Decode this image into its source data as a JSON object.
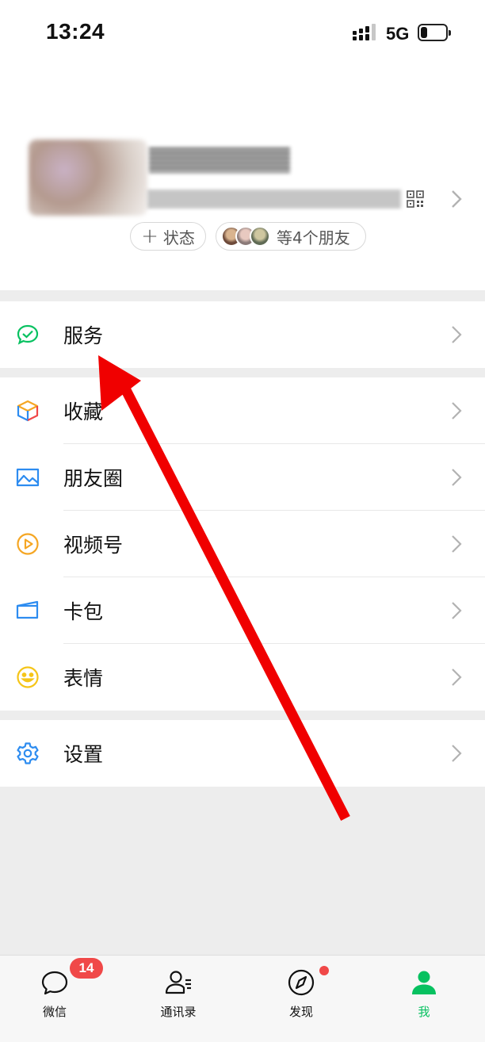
{
  "status_bar": {
    "time": "13:24",
    "network": "5G"
  },
  "profile": {
    "status_label": "状态",
    "friends_label": "等4个朋友"
  },
  "menu": {
    "service": "服务",
    "favorites": "收藏",
    "moments": "朋友圈",
    "channels": "视频号",
    "cards": "卡包",
    "stickers": "表情",
    "settings": "设置"
  },
  "tabbar": {
    "chats": "微信",
    "chats_badge": "14",
    "contacts": "通讯录",
    "discover": "发现",
    "me": "我"
  },
  "colors": {
    "accent_green": "#07c160",
    "badge_red": "#f04848",
    "annotation_arrow": "#f00000"
  }
}
